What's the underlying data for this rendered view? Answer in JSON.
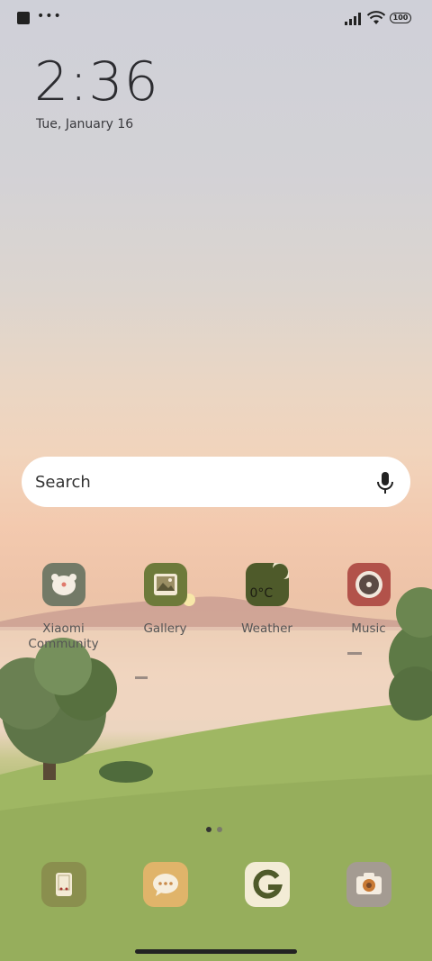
{
  "status_bar": {
    "left_icons": [
      "square-notification-icon",
      "more-dots-icon"
    ],
    "battery": "100"
  },
  "lockscreen": {
    "time": "2:36",
    "date": "Tue, January 16"
  },
  "search": {
    "label": "Search",
    "icon": "mic-icon"
  },
  "apps": [
    {
      "label": "Xiaomi\nCommunity",
      "icon": "xiaomi-community-icon",
      "color": "#737a67"
    },
    {
      "label": "Gallery",
      "icon": "gallery-icon",
      "color": "#6d7a3a"
    },
    {
      "label": "Weather",
      "icon": "weather-icon",
      "color": "#4e5a2a",
      "temp": "0°C"
    },
    {
      "label": "Music",
      "icon": "music-icon",
      "color": "#b2524a"
    }
  ],
  "page_indicator": {
    "pages": 2,
    "current": 1
  },
  "dock": [
    {
      "icon": "phone-icon",
      "color": "#8a8f4e"
    },
    {
      "icon": "messages-icon",
      "color": "#e0b46a"
    },
    {
      "icon": "google-icon",
      "color": "#f3ecd6"
    },
    {
      "icon": "camera-icon",
      "color": "#a49b92"
    }
  ]
}
